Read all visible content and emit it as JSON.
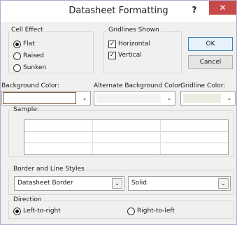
{
  "window": {
    "title": "Datasheet Formatting",
    "help_glyph": "?",
    "close_glyph": "✕"
  },
  "cell_effect": {
    "label": "Cell Effect",
    "options": [
      {
        "label": "Flat",
        "selected": true
      },
      {
        "label": "Raised",
        "selected": false
      },
      {
        "label": "Sunken",
        "selected": false
      }
    ]
  },
  "gridlines": {
    "label": "Gridlines Shown",
    "horizontal": {
      "label": "Horizontal",
      "checked": true
    },
    "vertical": {
      "label": "Vertical",
      "checked": true
    }
  },
  "buttons": {
    "ok": "OK",
    "cancel": "Cancel"
  },
  "colors": {
    "background_label": "Background Color:",
    "alternate_label": "Alternate Background Color:",
    "gridline_label": "Gridline Color:",
    "background_value": "#ffffff",
    "alternate_value": "#f2f2f2",
    "gridline_value": "#ecebdf"
  },
  "sample": {
    "label": "Sample:"
  },
  "border_styles": {
    "label": "Border and Line Styles",
    "border_value": "Datasheet Border",
    "line_value": "Solid"
  },
  "direction": {
    "label": "Direction",
    "left_to_right": {
      "label": "Left-to-right",
      "selected": true
    },
    "right_to_left": {
      "label": "Right-to-left",
      "selected": false
    }
  }
}
